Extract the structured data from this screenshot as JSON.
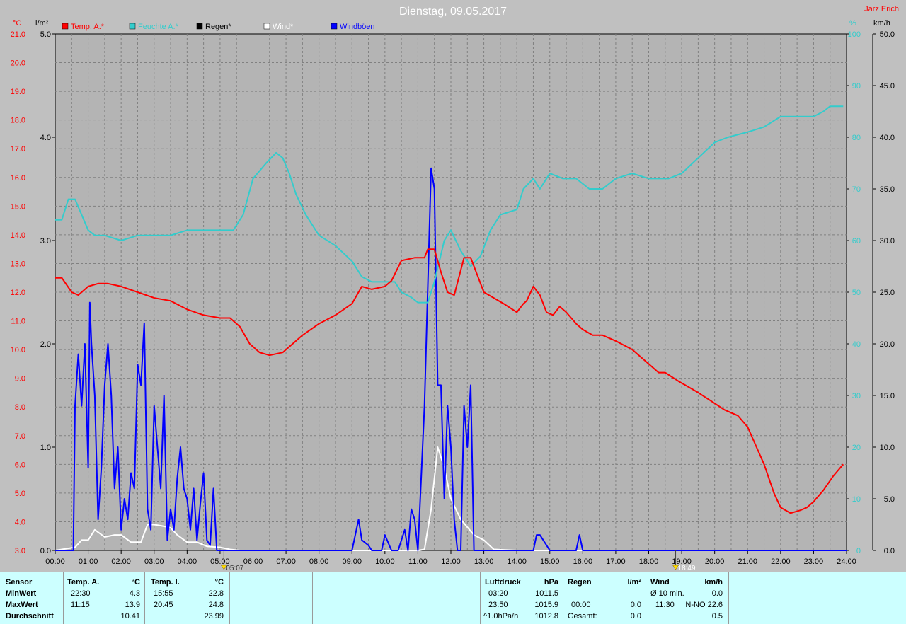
{
  "title": "Dienstag, 09.05.2017",
  "author": "Jarz Erich",
  "colors": {
    "temp": "#ff0000",
    "humidity": "#33cccc",
    "rain": "#000000",
    "wind": "#ffffff",
    "gust": "#0000ff",
    "plot_bg": "#b4b4b4",
    "frame_bg": "#c0c0c0",
    "stats_bg": "#ccffff"
  },
  "sun": {
    "rise": "05:07",
    "set": "18:49"
  },
  "chart_data": {
    "type": "line",
    "x_unit": "hours",
    "x_ticks": [
      "00:00",
      "01:00",
      "02:00",
      "03:00",
      "04:00",
      "05:00",
      "06:00",
      "07:00",
      "08:00",
      "09:00",
      "10:00",
      "11:00",
      "12:00",
      "13:00",
      "14:00",
      "15:00",
      "16:00",
      "17:00",
      "18:00",
      "19:00",
      "20:00",
      "21:00",
      "22:00",
      "23:00",
      "24:00"
    ],
    "axes": {
      "temp": {
        "label": "°C",
        "min": 3.0,
        "max": 21.0,
        "ticks": [
          "3.0",
          "4.0",
          "5.0",
          "6.0",
          "7.0",
          "8.0",
          "9.0",
          "10.0",
          "11.0",
          "12.0",
          "13.0",
          "14.0",
          "15.0",
          "16.0",
          "17.0",
          "18.0",
          "19.0",
          "20.0",
          "21.0"
        ]
      },
      "rain": {
        "label": "l/m²",
        "min": 0.0,
        "max": 5.0,
        "ticks": [
          "0.0",
          "1.0",
          "2.0",
          "3.0",
          "4.0",
          "5.0"
        ]
      },
      "humidity": {
        "label": "%",
        "min": 0,
        "max": 100,
        "ticks": [
          "0",
          "10",
          "20",
          "30",
          "40",
          "50",
          "60",
          "70",
          "80",
          "90",
          "100"
        ]
      },
      "wind": {
        "label": "km/h",
        "min": 0.0,
        "max": 50.0,
        "ticks": [
          "0.0",
          "5.0",
          "10.0",
          "15.0",
          "20.0",
          "25.0",
          "30.0",
          "35.0",
          "40.0",
          "45.0",
          "50.0"
        ]
      }
    },
    "series": [
      {
        "name": "Temp. A.*",
        "axis": "temp",
        "color": "#ff0000",
        "x": [
          0,
          0.2,
          0.5,
          0.7,
          1.0,
          1.3,
          1.6,
          2.0,
          2.5,
          3.0,
          3.5,
          4.0,
          4.5,
          5.0,
          5.3,
          5.6,
          5.9,
          6.2,
          6.5,
          6.9,
          7.2,
          7.5,
          8.0,
          8.5,
          9.0,
          9.3,
          9.6,
          10.0,
          10.2,
          10.5,
          10.9,
          11.2,
          11.3,
          11.5,
          11.7,
          11.9,
          12.1,
          12.4,
          12.6,
          12.8,
          13.0,
          13.3,
          13.6,
          14.0,
          14.2,
          14.3,
          14.5,
          14.7,
          14.9,
          15.1,
          15.3,
          15.5,
          15.8,
          16.0,
          16.3,
          16.6,
          17.0,
          17.5,
          18.0,
          18.3,
          18.5,
          18.9,
          19.2,
          19.5,
          19.9,
          20.3,
          20.7,
          21.0,
          21.5,
          21.8,
          22.0,
          22.3,
          22.6,
          22.8,
          23.0,
          23.3,
          23.6,
          23.9
        ],
        "y": [
          12.5,
          12.5,
          12.0,
          11.9,
          12.2,
          12.3,
          12.3,
          12.2,
          12.0,
          11.8,
          11.7,
          11.4,
          11.2,
          11.1,
          11.1,
          10.8,
          10.2,
          9.9,
          9.8,
          9.9,
          10.2,
          10.5,
          10.9,
          11.2,
          11.6,
          12.2,
          12.1,
          12.2,
          12.4,
          13.1,
          13.2,
          13.2,
          13.5,
          13.5,
          12.7,
          12.0,
          11.9,
          13.2,
          13.2,
          12.6,
          12.0,
          11.8,
          11.6,
          11.3,
          11.6,
          11.7,
          12.2,
          11.9,
          11.3,
          11.2,
          11.5,
          11.3,
          10.9,
          10.7,
          10.5,
          10.5,
          10.3,
          10.0,
          9.5,
          9.2,
          9.2,
          8.9,
          8.7,
          8.5,
          8.2,
          7.9,
          7.7,
          7.3,
          6.0,
          5.0,
          4.5,
          4.3,
          4.4,
          4.5,
          4.7,
          5.1,
          5.6,
          6.0
        ]
      },
      {
        "name": "Feuchte A.*",
        "axis": "humidity",
        "color": "#33cccc",
        "x": [
          0,
          0.2,
          0.4,
          0.6,
          0.8,
          1.0,
          1.2,
          1.5,
          2.0,
          2.5,
          3.0,
          3.5,
          4.0,
          4.5,
          5.0,
          5.4,
          5.7,
          6.0,
          6.4,
          6.7,
          6.9,
          7.1,
          7.3,
          7.6,
          8.0,
          8.5,
          9.0,
          9.3,
          9.6,
          10.0,
          10.3,
          10.5,
          10.8,
          11.0,
          11.3,
          11.5,
          11.8,
          12.0,
          12.3,
          12.6,
          12.9,
          13.2,
          13.5,
          14.0,
          14.2,
          14.5,
          14.7,
          15.0,
          15.4,
          15.8,
          16.2,
          16.6,
          17.0,
          17.5,
          18.0,
          18.6,
          19.0,
          19.5,
          20.0,
          20.4,
          21.0,
          21.5,
          22.0,
          22.5,
          23.0,
          23.3,
          23.5,
          23.8,
          23.9
        ],
        "y": [
          64,
          64,
          68,
          68,
          65,
          62,
          61,
          61,
          60,
          61,
          61,
          61,
          62,
          62,
          62,
          62,
          65,
          72,
          75,
          77,
          76,
          73,
          69,
          65,
          61,
          59,
          56,
          53,
          52,
          52,
          52,
          50,
          49,
          48,
          48,
          52,
          60,
          62,
          58,
          55,
          57,
          62,
          65,
          66,
          70,
          72,
          70,
          73,
          72,
          72,
          70,
          70,
          72,
          73,
          72,
          72,
          73,
          76,
          79,
          80,
          81,
          82,
          84,
          84,
          84,
          85,
          86,
          86,
          86
        ]
      },
      {
        "name": "Regen*",
        "axis": "rain",
        "color": "#000000",
        "x": [
          0,
          24
        ],
        "y": [
          0.0,
          0.0
        ]
      },
      {
        "name": "Wind*",
        "axis": "wind",
        "color": "#ffffff",
        "x": [
          0,
          0.6,
          0.8,
          1.0,
          1.2,
          1.5,
          1.8,
          2.0,
          2.3,
          2.6,
          2.8,
          3.0,
          3.2,
          3.5,
          3.7,
          4.0,
          4.3,
          4.6,
          5.0,
          5.3,
          5.6,
          11.0,
          11.2,
          11.4,
          11.6,
          11.8,
          12.0,
          12.3,
          12.7,
          13.0,
          13.3,
          14.0,
          24.0
        ],
        "y": [
          0,
          0.3,
          1.0,
          1.0,
          2.0,
          1.3,
          1.5,
          1.5,
          0.8,
          0.8,
          2.5,
          2.5,
          2.4,
          2.2,
          1.5,
          0.8,
          0.8,
          0.4,
          0.3,
          0.1,
          0,
          0,
          0.1,
          4.0,
          10.0,
          8.0,
          5.0,
          3.0,
          1.5,
          1.0,
          0.1,
          0,
          0
        ]
      },
      {
        "name": "Windböen",
        "axis": "wind",
        "color": "#0000ff",
        "x": [
          0,
          0.55,
          0.6,
          0.7,
          0.8,
          0.9,
          1.0,
          1.05,
          1.1,
          1.2,
          1.3,
          1.4,
          1.5,
          1.6,
          1.7,
          1.8,
          1.9,
          2.0,
          2.1,
          2.2,
          2.3,
          2.4,
          2.5,
          2.6,
          2.7,
          2.8,
          2.9,
          3.0,
          3.1,
          3.2,
          3.3,
          3.4,
          3.5,
          3.6,
          3.7,
          3.8,
          3.9,
          4.0,
          4.1,
          4.2,
          4.3,
          4.4,
          4.5,
          4.6,
          4.7,
          4.8,
          4.9,
          5.0,
          5.1,
          5.2,
          5.3,
          9.0,
          9.2,
          9.3,
          9.5,
          9.6,
          9.9,
          10.0,
          10.2,
          10.4,
          10.6,
          10.7,
          10.8,
          10.9,
          11.0,
          11.2,
          11.4,
          11.5,
          11.6,
          11.7,
          11.8,
          11.9,
          12.0,
          12.1,
          12.2,
          12.3,
          12.4,
          12.5,
          12.6,
          12.7,
          12.8,
          12.9,
          13.0,
          13.1,
          13.2,
          13.3,
          14.0,
          14.5,
          14.6,
          14.7,
          15.0,
          15.8,
          15.9,
          16.0,
          24.0
        ],
        "y": [
          0,
          0,
          14.0,
          19.0,
          14.0,
          20.0,
          8.0,
          24.0,
          20.0,
          15.0,
          3.0,
          8.0,
          16.0,
          20.0,
          15.0,
          6.0,
          10.0,
          2.0,
          5.0,
          3.0,
          7.5,
          6.0,
          18.0,
          16.0,
          22.0,
          4.0,
          2.0,
          14.0,
          10.0,
          6.0,
          15.0,
          1.0,
          4.0,
          2.0,
          7.0,
          10.0,
          6.0,
          5.0,
          2.0,
          6.0,
          1.0,
          4.5,
          7.5,
          1.0,
          0.5,
          6.0,
          0.0,
          0,
          0,
          0,
          0,
          0,
          3.0,
          1.0,
          0.5,
          0,
          0,
          1.5,
          0,
          0,
          2.0,
          0,
          4.0,
          3.0,
          0,
          14.0,
          37.0,
          35.0,
          16.0,
          16.0,
          5.0,
          14.0,
          10.0,
          3.0,
          0,
          0,
          14.0,
          10.0,
          16.0,
          0,
          0,
          0,
          0,
          0,
          0,
          0,
          0,
          0,
          1.5,
          1.5,
          0,
          0,
          1.5,
          0,
          0
        ]
      }
    ]
  },
  "stats": {
    "sensor": {
      "header": "Sensor",
      "rows": [
        "MinWert",
        "MaxWert",
        "Durchschnitt"
      ]
    },
    "temp_a": {
      "header": "Temp. A.",
      "unit": "°C",
      "min_time": "22:30",
      "min_val": "4.3",
      "max_time": "11:15",
      "max_val": "13.9",
      "avg": "10.41"
    },
    "temp_i": {
      "header": "Temp. I.",
      "unit": "°C",
      "min_time": "15:55",
      "min_val": "22.8",
      "max_time": "20:45",
      "max_val": "24.8",
      "avg": "23.99"
    },
    "pressure": {
      "header": "Luftdruck",
      "unit": "hPa",
      "min_time": "03:20",
      "min_val": "1011.5",
      "max_time": "23:50",
      "max_val": "1015.9",
      "trend_label": "^1.0hPa/h",
      "trend_val": "1012.8"
    },
    "rain": {
      "header": "Regen",
      "unit": "l/m²",
      "time": "00:00",
      "val": "0.0",
      "total_label": "Gesamt:",
      "total_val": "0.0"
    },
    "wind": {
      "header": "Wind",
      "unit": "km/h",
      "avg_label": "Ø 10 min.",
      "avg_val": "0.0",
      "max_time": "11:30",
      "max_val": "N-NO 22.6",
      "extra_val": "0.5"
    }
  }
}
